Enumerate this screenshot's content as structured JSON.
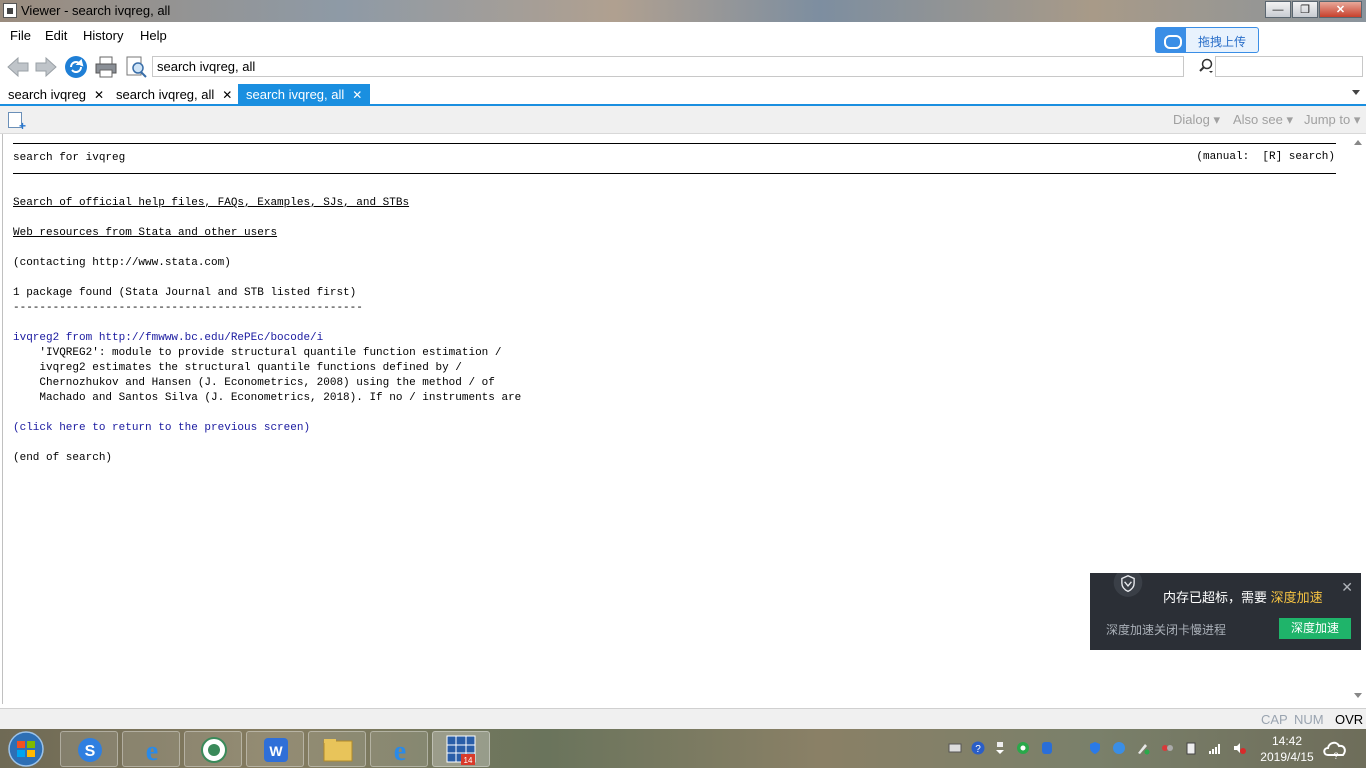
{
  "window": {
    "title": "Viewer - search ivqreg, all"
  },
  "menu": {
    "file": "File",
    "edit": "Edit",
    "history": "History",
    "help": "Help"
  },
  "upload_widget": {
    "label": "拖拽上传"
  },
  "toolbar": {
    "address_value": "search ivqreg, all",
    "search_value": ""
  },
  "tabs": [
    {
      "label": "search ivqreg",
      "close": "✕"
    },
    {
      "label": "search ivqreg, all",
      "close": "✕"
    },
    {
      "label": "search ivqreg, all",
      "close": "✕"
    }
  ],
  "subtoolbar": {
    "dialog": "Dialog",
    "also_see": "Also see",
    "jump_to": "Jump to"
  },
  "content": {
    "header_left": "search for ivqreg",
    "header_right": "(manual:  [R] search)",
    "link_official": "Search of official help files, FAQs, Examples, SJs, and STBs",
    "link_web": "Web resources from Stata and other users",
    "contacting": "(contacting http://www.stata.com)",
    "found": "1 package found (Stata Journal and STB listed first)",
    "dashes": "-----------------------------------------------------",
    "pkg_link": "ivqreg2 from http://fmwww.bc.edu/RePEc/bocode/i",
    "desc1": "    'IVQREG2': module to provide structural quantile function estimation /",
    "desc2": "    ivqreg2 estimates the structural quantile functions defined by /",
    "desc3": "    Chernozhukov and Hansen (J. Econometrics, 2008) using the method / of",
    "desc4": "    Machado and Santos Silva (J. Econometrics, 2018). If no / instruments are",
    "return_link": "(click here to return to the previous screen)",
    "end": "(end of search)"
  },
  "statusbar": {
    "cap": "CAP",
    "num": "NUM",
    "ovr": "OVR"
  },
  "popup": {
    "title_main": "内存已超标，需要 ",
    "title_highlight": "深度加速",
    "close": "✕",
    "subtitle": "深度加速关闭卡慢进程",
    "button": "深度加速"
  },
  "taskbar": {
    "time": "14:42",
    "date": "2019/4/15",
    "badge": "14"
  },
  "colors": {
    "accent_blue": "#1a8fe0",
    "link_blue": "#1a1aa0",
    "popup_bg": "#2b2f36",
    "popup_button": "#1fb46a",
    "popup_highlight": "#f6c342"
  }
}
